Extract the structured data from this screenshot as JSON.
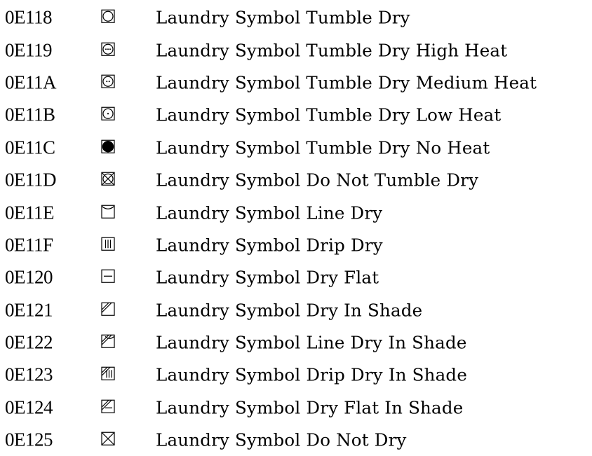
{
  "rows": [
    {
      "code": "0E118",
      "icon": "tumble-dry-icon",
      "name": "Laundry Symbol Tumble Dry"
    },
    {
      "code": "0E119",
      "icon": "tumble-dry-high-heat-icon",
      "name": "Laundry Symbol Tumble Dry High Heat"
    },
    {
      "code": "0E11A",
      "icon": "tumble-dry-medium-heat-icon",
      "name": "Laundry Symbol Tumble Dry Medium Heat"
    },
    {
      "code": "0E11B",
      "icon": "tumble-dry-low-heat-icon",
      "name": "Laundry Symbol Tumble Dry Low Heat"
    },
    {
      "code": "0E11C",
      "icon": "tumble-dry-no-heat-icon",
      "name": "Laundry Symbol Tumble Dry No Heat"
    },
    {
      "code": "0E11D",
      "icon": "do-not-tumble-dry-icon",
      "name": "Laundry Symbol Do Not Tumble Dry"
    },
    {
      "code": "0E11E",
      "icon": "line-dry-icon",
      "name": "Laundry Symbol Line Dry"
    },
    {
      "code": "0E11F",
      "icon": "drip-dry-icon",
      "name": "Laundry Symbol Drip Dry"
    },
    {
      "code": "0E120",
      "icon": "dry-flat-icon",
      "name": "Laundry Symbol Dry Flat"
    },
    {
      "code": "0E121",
      "icon": "dry-in-shade-icon",
      "name": "Laundry Symbol Dry In Shade"
    },
    {
      "code": "0E122",
      "icon": "line-dry-in-shade-icon",
      "name": "Laundry Symbol Line Dry In Shade"
    },
    {
      "code": "0E123",
      "icon": "drip-dry-in-shade-icon",
      "name": "Laundry Symbol Drip Dry In Shade"
    },
    {
      "code": "0E124",
      "icon": "dry-flat-in-shade-icon",
      "name": "Laundry Symbol Dry Flat In Shade"
    },
    {
      "code": "0E125",
      "icon": "do-not-dry-icon",
      "name": "Laundry Symbol Do Not Dry"
    }
  ]
}
